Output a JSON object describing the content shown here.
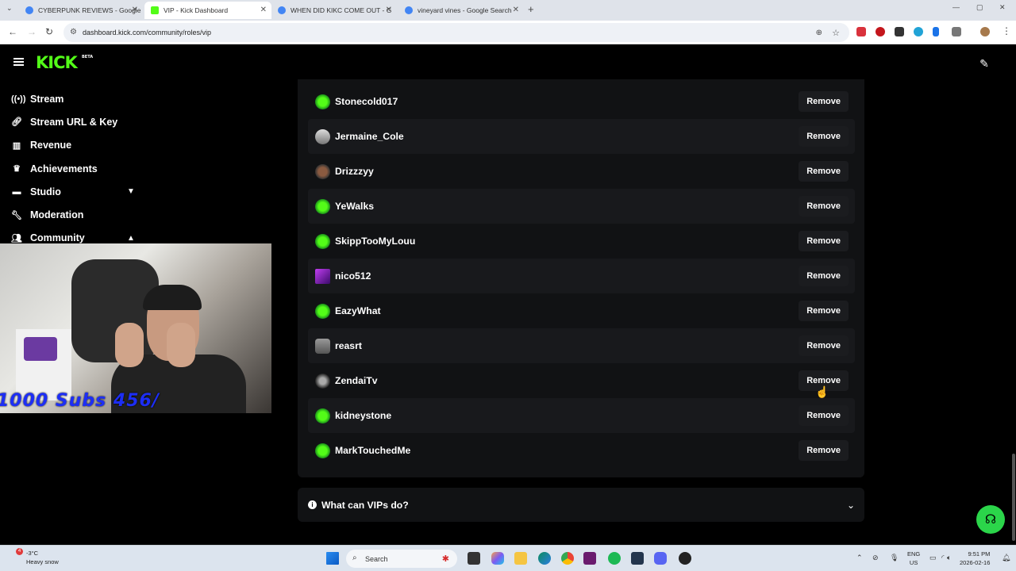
{
  "browser": {
    "tabs": [
      {
        "title": "CYBERPUNK REVIEWS - Google",
        "color": "#4285f4"
      },
      {
        "title": "VIP - Kick Dashboard",
        "color": "#53fc18"
      },
      {
        "title": "WHEN DID KIKC COME OUT - G",
        "color": "#4285f4"
      },
      {
        "title": "vineyard vines - Google Search",
        "color": "#4285f4"
      }
    ],
    "url": "dashboard.kick.com/community/roles/vip"
  },
  "app": {
    "logo": "KICK",
    "logo_badge": "BETA",
    "accent": "#53fc18"
  },
  "sidebar": {
    "items": [
      {
        "label": "Stream",
        "icon": "broadcast-icon"
      },
      {
        "label": "Stream URL & Key",
        "icon": "link-icon"
      },
      {
        "label": "Revenue",
        "icon": "bar-chart-icon"
      },
      {
        "label": "Achievements",
        "icon": "trophy-icon"
      },
      {
        "label": "Studio",
        "icon": "studio-icon"
      },
      {
        "label": "Moderation",
        "icon": "wrench-icon"
      },
      {
        "label": "Community",
        "icon": "community-icon"
      }
    ]
  },
  "webcam": {
    "overlay_text": "1000 Subs 456/"
  },
  "vips": {
    "remove_label": "Remove",
    "users": [
      {
        "name": "Stonecold017",
        "avatar": "kick-default"
      },
      {
        "name": "Jermaine_Cole",
        "avatar": "photo"
      },
      {
        "name": "Drizzzyy",
        "avatar": "photo"
      },
      {
        "name": "YeWalks",
        "avatar": "kick-default"
      },
      {
        "name": "SkippTooMyLouu",
        "avatar": "kick-default"
      },
      {
        "name": "nico512",
        "avatar": "purple"
      },
      {
        "name": "EazyWhat",
        "avatar": "kick-default"
      },
      {
        "name": "reasrt",
        "avatar": "photo"
      },
      {
        "name": "ZendaiTv",
        "avatar": "photo"
      },
      {
        "name": "kidneystone",
        "avatar": "kick-default"
      },
      {
        "name": "MarkTouchedMe",
        "avatar": "kick-default"
      }
    ]
  },
  "faq": {
    "label": "What can VIPs do?"
  },
  "taskbar": {
    "weather_temp": "-3°C",
    "weather_desc": "Heavy snow",
    "weather_badge": "4",
    "search_placeholder": "Search",
    "lang_top": "ENG",
    "lang_bottom": "US",
    "time": "9:51 PM",
    "date": "2026-02-16"
  }
}
